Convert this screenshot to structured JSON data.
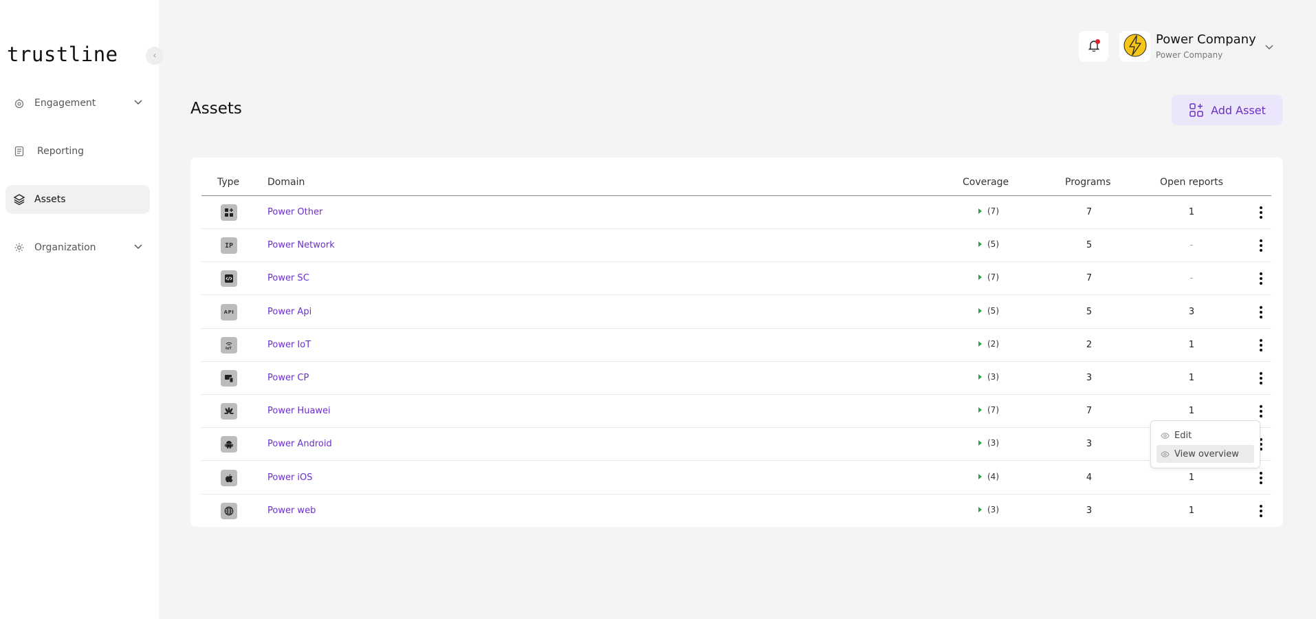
{
  "app": {
    "logo_text": "trustline"
  },
  "sidebar": {
    "collapse_icon": "chevron-left-icon",
    "items": [
      {
        "label": "Engagement",
        "icon": "engagement-icon",
        "has_chevron": true
      },
      {
        "label": "Reporting",
        "icon": "document-icon",
        "has_chevron": false
      },
      {
        "label": "Assets",
        "icon": "layers-icon",
        "has_chevron": false,
        "active": true
      },
      {
        "label": "Organization",
        "icon": "gear-icon",
        "has_chevron": true
      }
    ]
  },
  "header": {
    "notification_icon": "bell-icon",
    "company_name": "Power Company",
    "company_subtitle": "Power Company",
    "avatar_icon": "lightning-icon"
  },
  "main": {
    "title": "Assets",
    "add_button_label": "Add Asset"
  },
  "table": {
    "columns": {
      "type": "Type",
      "domain": "Domain",
      "coverage": "Coverage",
      "programs": "Programs",
      "open_reports": "Open reports"
    },
    "rows": [
      {
        "type_icon": "other-icon",
        "domain": "Power Other",
        "coverage": "(7)",
        "programs": "7",
        "open_reports": "1"
      },
      {
        "type_icon": "ip-icon",
        "domain": "Power Network",
        "coverage": "(5)",
        "programs": "5",
        "open_reports": "-"
      },
      {
        "type_icon": "code-icon",
        "domain": "Power SC",
        "coverage": "(7)",
        "programs": "7",
        "open_reports": "-"
      },
      {
        "type_icon": "api-icon",
        "domain": "Power Api",
        "coverage": "(5)",
        "programs": "5",
        "open_reports": "3"
      },
      {
        "type_icon": "iot-icon",
        "domain": "Power IoT",
        "coverage": "(2)",
        "programs": "2",
        "open_reports": "1"
      },
      {
        "type_icon": "cp-icon",
        "domain": "Power CP",
        "coverage": "(3)",
        "programs": "3",
        "open_reports": "1"
      },
      {
        "type_icon": "huawei-icon",
        "domain": "Power Huawei",
        "coverage": "(7)",
        "programs": "7",
        "open_reports": "1"
      },
      {
        "type_icon": "android-icon",
        "domain": "Power Android",
        "coverage": "(3)",
        "programs": "3",
        "open_reports": ""
      },
      {
        "type_icon": "apple-icon",
        "domain": "Power iOS",
        "coverage": "(4)",
        "programs": "4",
        "open_reports": "1"
      },
      {
        "type_icon": "globe-icon",
        "domain": "Power web",
        "coverage": "(3)",
        "programs": "3",
        "open_reports": "1"
      }
    ]
  },
  "row_menu": {
    "items": [
      {
        "label": "Edit",
        "icon": "eye-icon"
      },
      {
        "label": "View overview",
        "icon": "eye-icon",
        "highlighted": true
      }
    ]
  },
  "colors": {
    "accent": "#6a2fc9",
    "accent_bg": "#ece6fb",
    "coverage_arrow": "#2aa04f",
    "notification_dot": "#e0242f"
  }
}
